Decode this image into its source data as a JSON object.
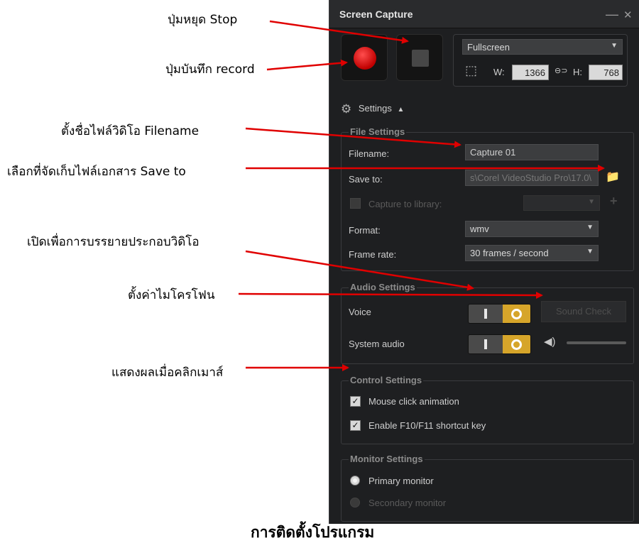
{
  "annotations": {
    "stop": "ปุ่มหยุด Stop",
    "record": "ปุ่มบันทึก record",
    "filename": "ตั้งชื่อไฟล์วิดิโอ  Filename",
    "save_to": "เลือกที่จัดเก็บไฟล์เอกสาร Save to",
    "voice": "เปิดเพื่อการบรรยายประกอบวิดิโอ",
    "sound_check": "ตั้งค่าไมโครโฟน",
    "mouse": "แสดงผลเมื่อคลิกเมาส์",
    "caption": "การติดตั้งโปรแกรม"
  },
  "window": {
    "title": "Screen Capture",
    "minimize_glyph": "—",
    "close_glyph": "✕"
  },
  "capture": {
    "mode": "Fullscreen",
    "width_label": "W:",
    "width": "1366",
    "height_label": "H:",
    "height": "768",
    "link_glyph": "⊖⊃"
  },
  "settings": {
    "label": "Settings",
    "toggle_glyph": "▲"
  },
  "file_settings": {
    "title": "File Settings",
    "filename_label": "Filename:",
    "filename": "Capture 01",
    "save_to_label": "Save to:",
    "save_to": "s\\Corel VideoStudio Pro\\17.0\\",
    "capture_to_library_label": "Capture to library:",
    "format_label": "Format:",
    "format": "wmv",
    "frame_rate_label": "Frame rate:",
    "frame_rate": "30 frames / second"
  },
  "audio_settings": {
    "title": "Audio Settings",
    "voice_label": "Voice",
    "sound_check_label": "Sound Check",
    "system_audio_label": "System audio"
  },
  "control_settings": {
    "title": "Control Settings",
    "mouse_click_label": "Mouse click animation",
    "shortcut_label": "Enable F10/F11 shortcut key",
    "check_glyph": "✓"
  },
  "monitor_settings": {
    "title": "Monitor Settings",
    "primary_label": "Primary monitor",
    "secondary_label": "Secondary monitor"
  },
  "glyphs": {
    "dropdown_arrow": "▼",
    "folder_icon": "📁",
    "plus_icon": "+",
    "speaker_icon": "◀)",
    "gear_icon": "⚙",
    "region_icon": "⬚"
  },
  "colors": {
    "record_red": "#d00000",
    "toggle_gold": "#d6a52a",
    "panel_bg": "#1e1f21",
    "arrow_red": "#e00000"
  }
}
